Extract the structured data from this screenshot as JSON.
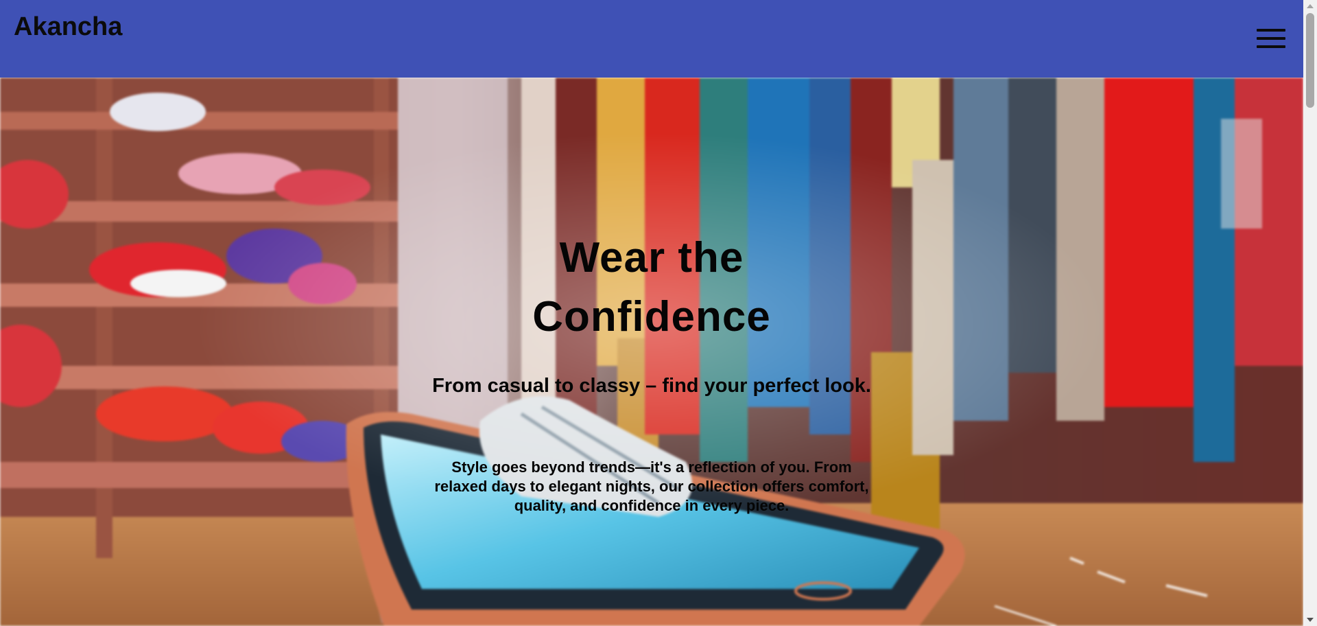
{
  "header": {
    "brand": "Akancha",
    "menu_icon": "hamburger-menu-icon"
  },
  "hero": {
    "title": "Wear the Confidence",
    "subtitle": "From casual to classy – find your perfect look.",
    "description": "Style goes beyond trends—it's a reflection of you. From relaxed days to elegant nights, our collection offers comfort, quality, and confidence in every piece.",
    "background_image": "clothing-store-with-shoe-on-phone"
  },
  "colors": {
    "navbar": "#3f51b5",
    "text": "#050505"
  }
}
